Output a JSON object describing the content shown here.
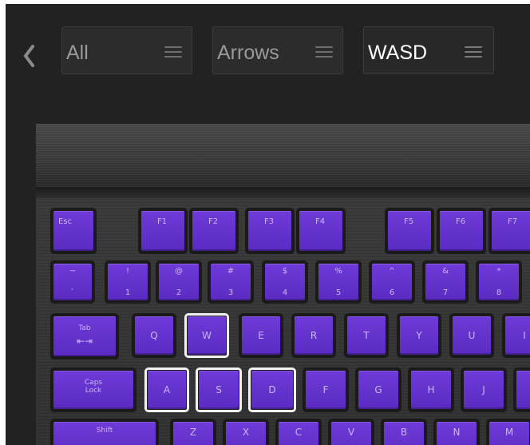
{
  "header": {
    "back_icon": "chevron-left-icon",
    "presets": [
      {
        "label": "All",
        "menu_icon": "menu-icon"
      },
      {
        "label": "Arrows",
        "menu_icon": "menu-icon"
      },
      {
        "label": "WASD",
        "menu_icon": "menu-icon",
        "active": true
      }
    ]
  },
  "keyboard": {
    "backlight_color": "#6232cf",
    "selection_color": "#f2f2f2",
    "function_row": [
      "Esc",
      "F1",
      "F2",
      "F3",
      "F4",
      "F5",
      "F6",
      "F7"
    ],
    "number_row": [
      {
        "top": "~",
        "bottom": "`"
      },
      {
        "top": "!",
        "bottom": "1"
      },
      {
        "top": "@",
        "bottom": "2"
      },
      {
        "top": "#",
        "bottom": "3"
      },
      {
        "top": "$",
        "bottom": "4"
      },
      {
        "top": "%",
        "bottom": "5"
      },
      {
        "top": "^",
        "bottom": "6"
      },
      {
        "top": "&",
        "bottom": "7"
      },
      {
        "top": "*",
        "bottom": "8"
      }
    ],
    "qwerty_row": {
      "tab": "Tab",
      "keys": [
        "Q",
        "W",
        "E",
        "R",
        "T",
        "Y",
        "U",
        "I"
      ]
    },
    "home_row": {
      "caps_top": "Caps",
      "caps_bottom": "Lock",
      "keys": [
        "A",
        "S",
        "D",
        "F",
        "G",
        "H",
        "J"
      ]
    },
    "bottom_row": {
      "shift": "Shift",
      "keys": [
        "Z",
        "X",
        "C",
        "V",
        "B",
        "N",
        "M"
      ]
    },
    "selected_keys": [
      "W",
      "A",
      "S",
      "D"
    ]
  }
}
